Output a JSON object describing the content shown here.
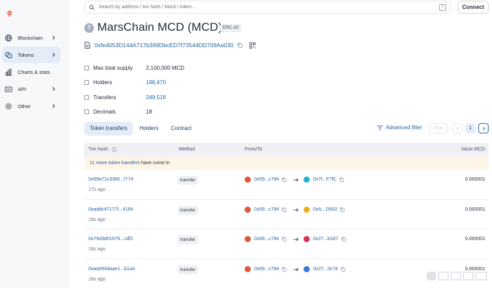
{
  "search": {
    "placeholder": "Search by address / txn hash / block / token...",
    "shortcut": "/"
  },
  "header": {
    "connect_label": "Connect"
  },
  "sidebar": {
    "items": [
      {
        "label": "Blockchain",
        "icon": "globe-icon",
        "has_chevron": true,
        "active": false
      },
      {
        "label": "Tokens",
        "icon": "tokens-icon",
        "has_chevron": true,
        "active": true
      },
      {
        "label": "Charts & stats",
        "icon": "chart-icon",
        "has_chevron": false,
        "active": false
      },
      {
        "label": "API",
        "icon": "api-icon",
        "has_chevron": true,
        "active": false
      },
      {
        "label": "Other",
        "icon": "gear-icon",
        "has_chevron": true,
        "active": false
      }
    ]
  },
  "token": {
    "avatar_letter": "T",
    "title": "MarsChain MCD (MCD)",
    "standard": "ERC-20",
    "address": "0xfe4053D144A717b399DbcED7f73544DD709Aa030"
  },
  "details": [
    {
      "label": "Max total supply",
      "value": "2,100,000 MCD",
      "is_link": false
    },
    {
      "label": "Holders",
      "value": "198,470",
      "is_link": true
    },
    {
      "label": "Transfers",
      "value": "249,518",
      "is_link": true
    },
    {
      "label": "Decimals",
      "value": "18",
      "is_link": false
    }
  ],
  "tabs": [
    {
      "label": "Token transfers",
      "active": true
    },
    {
      "label": "Holders",
      "active": false
    },
    {
      "label": "Contract",
      "active": false
    }
  ],
  "toolbar": {
    "advanced_filter": "Advanced filter",
    "first": "First",
    "page": "1"
  },
  "table": {
    "columns": {
      "txn_hash": "Txn hash",
      "method": "Method",
      "from_to": "From/To",
      "value": "Value MCD"
    },
    "notice": {
      "link": "11 more token transfers",
      "rest": "have come in"
    },
    "rows": [
      {
        "hash": "0x59a71c3368...f774",
        "age": "17s ago",
        "method": "transfer",
        "from": "0x09...c794",
        "to": "0x7f...F7fC",
        "value": "0.000001",
        "from_color": "#e0563a",
        "to_color": "#1fb3c8"
      },
      {
        "hash": "0xaddc47177f...4194",
        "age": "18s ago",
        "method": "transfer",
        "from": "0x09...c794",
        "to": "0xfc...D602",
        "value": "0.000001",
        "from_color": "#e0563a",
        "to_color": "#f0a91b"
      },
      {
        "hash": "0x79d3d01676...cdf1",
        "age": "18s ago",
        "method": "transfer",
        "from": "0x09...c794",
        "to": "0x27...b187",
        "value": "0.000001",
        "from_color": "#e0563a",
        "to_color": "#d9304f"
      },
      {
        "hash": "0xaa9934aae1...b1a4",
        "age": "18s ago",
        "method": "transfer",
        "from": "0x09...c794",
        "to": "0x27...3c76",
        "value": "0.000001",
        "from_color": "#e0563a",
        "to_color": "#3b7bd9"
      }
    ]
  },
  "colors": {
    "link": "#2563a6",
    "active_bg": "#e4ecf7",
    "notice_bg": "#fdf6e7",
    "brand": "#e0563a"
  }
}
